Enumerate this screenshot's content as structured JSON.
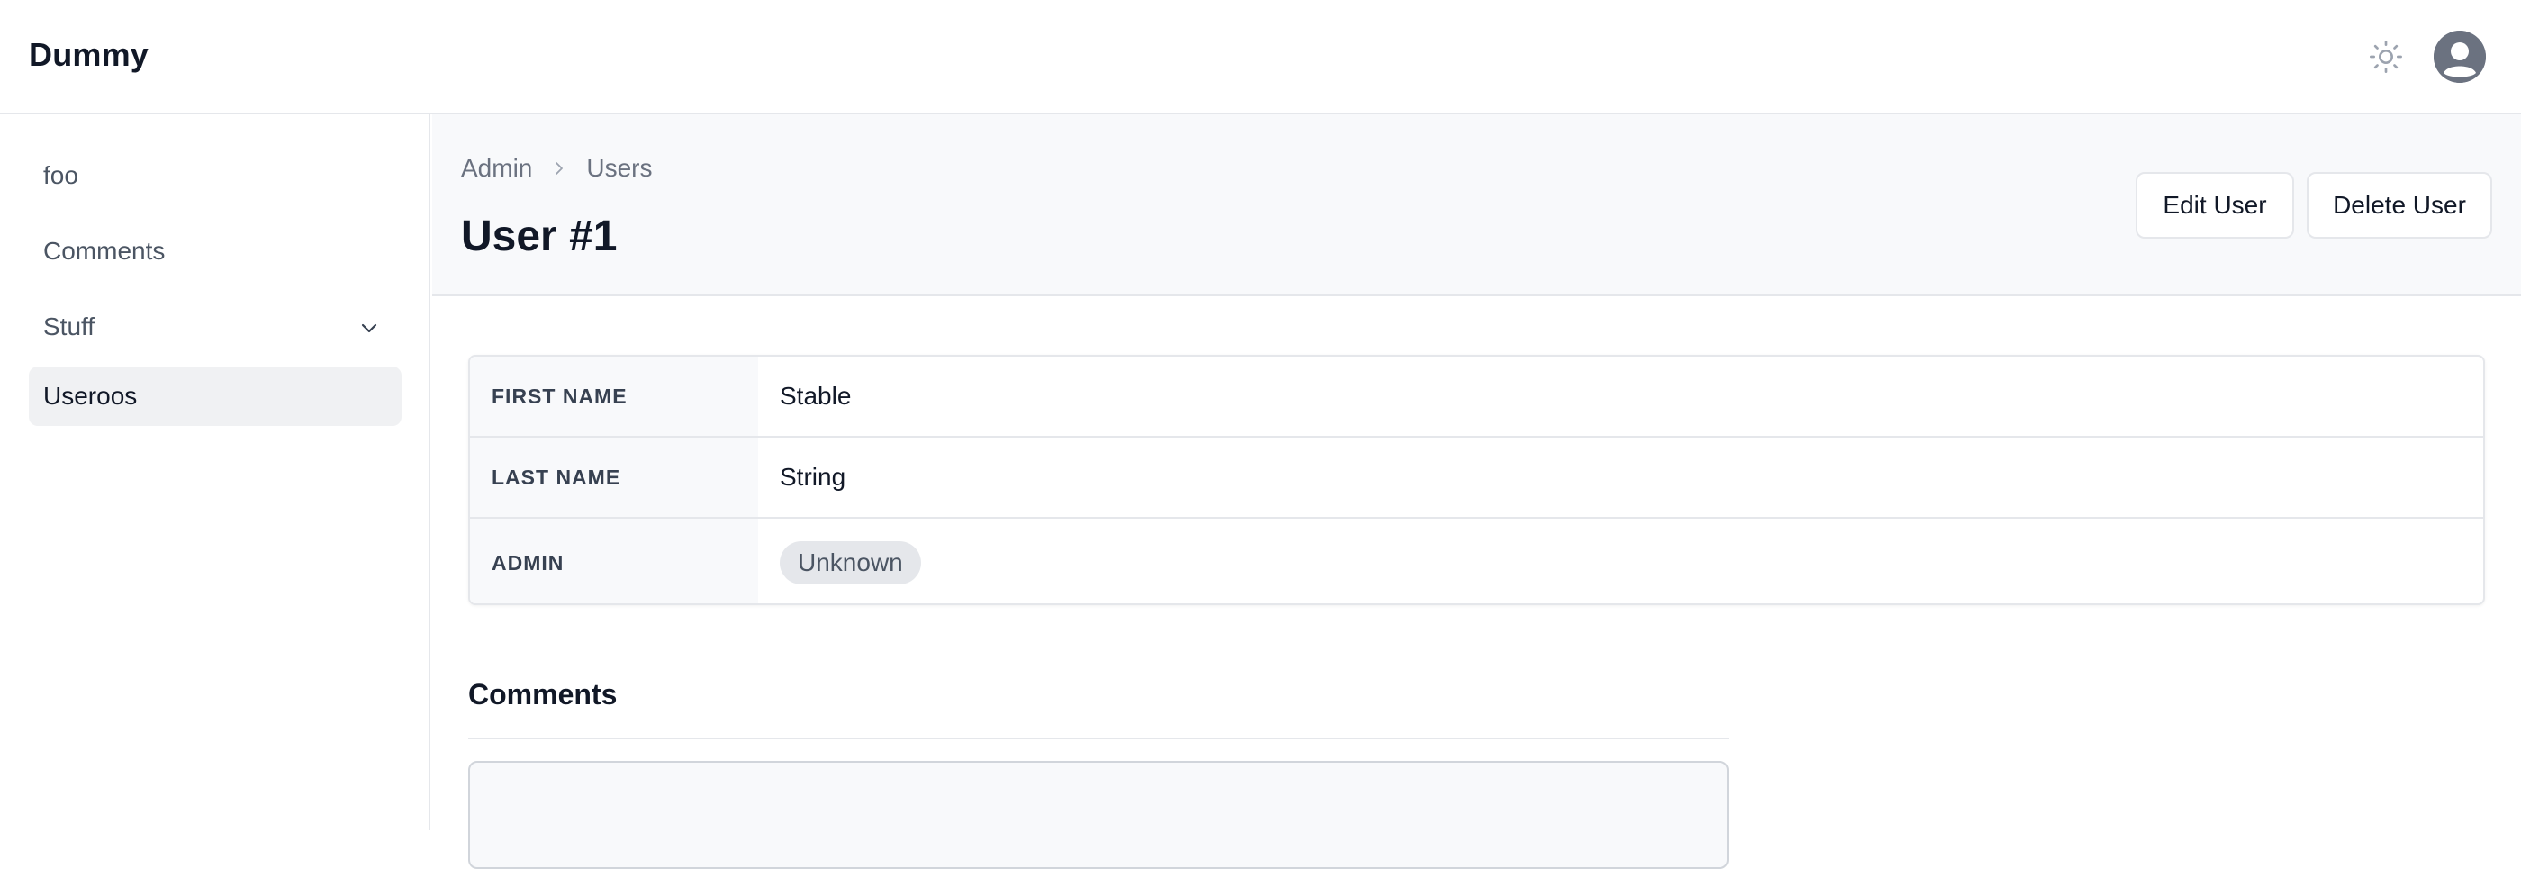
{
  "header": {
    "brand": "Dummy",
    "theme_icon": "sun-icon",
    "avatar_icon": "user-circle-icon"
  },
  "sidebar": {
    "items": [
      {
        "label": "foo"
      },
      {
        "label": "Comments"
      },
      {
        "label": "Stuff",
        "icon": "chevron-down-icon"
      },
      {
        "label": "Useroos",
        "active": true
      }
    ]
  },
  "main": {
    "breadcrumb": [
      "Admin",
      "Users"
    ],
    "title": "User #1",
    "actions": {
      "edit_label": "Edit User",
      "delete_label": "Delete User"
    },
    "details": [
      {
        "label": "FIRST NAME",
        "value": "Stable"
      },
      {
        "label": "LAST NAME",
        "value": "String"
      },
      {
        "label": "ADMIN",
        "value": "Unknown"
      }
    ],
    "comments_title": "Comments"
  },
  "colors": {
    "header_bg": "#ffffff",
    "page_header_bg": "#f8f9fb",
    "border": "#e5e7eb",
    "active_nav_bg": "#f0f1f3",
    "badge_bg": "#e5e7eb",
    "avatar": "#6b7280"
  }
}
